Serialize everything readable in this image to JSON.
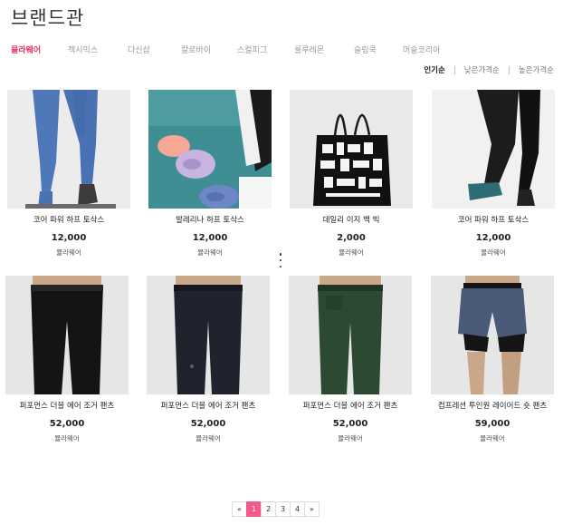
{
  "page": {
    "title": "브랜드관"
  },
  "brand_tabs": [
    {
      "label": "뮬라웨어",
      "active": true
    },
    {
      "label": "젝시믹스",
      "active": false
    },
    {
      "label": "다신샵",
      "active": false
    },
    {
      "label": "칼로바이",
      "active": false
    },
    {
      "label": "스컬피그",
      "active": false
    },
    {
      "label": "룰루레몬",
      "active": false
    },
    {
      "label": "슬림쿡",
      "active": false
    },
    {
      "label": "머슬코리아",
      "active": false
    }
  ],
  "sort_options": [
    {
      "label": "인기순",
      "active": true
    },
    {
      "label": "낮은가격순",
      "active": false
    },
    {
      "label": "높은가격순",
      "active": false
    }
  ],
  "products": [
    {
      "name": "코어 파워 하프 토삭스",
      "price": "12,000",
      "brand": "뮬라웨어",
      "image": "blue-leggings-photo"
    },
    {
      "name": "발레리나 하프 토삭스",
      "price": "12,000",
      "brand": "뮬라웨어",
      "image": "ballerina-socks-photo"
    },
    {
      "name": "데일리 이지 백 빅",
      "price": "2,000",
      "brand": "뮬라웨어",
      "image": "tote-bag-photo"
    },
    {
      "name": "코어 파워 하프 토삭스",
      "price": "12,000",
      "brand": "뮬라웨어",
      "image": "black-leggings-photo"
    },
    {
      "name": "퍼포먼스 더블 에어 조거 팬츠",
      "price": "52,000",
      "brand": "뮬라웨어",
      "image": "black-jogger-photo"
    },
    {
      "name": "퍼포먼스 더블 에어 조거 팬츠",
      "price": "52,000",
      "brand": "뮬라웨어",
      "image": "navy-jogger-photo"
    },
    {
      "name": "퍼포먼스 더블 에어 조거 팬츠",
      "price": "52,000",
      "brand": "뮬라웨어",
      "image": "green-jogger-photo"
    },
    {
      "name": "컴프레션 투인원 레이어드 숏 팬츠",
      "price": "59,000",
      "brand": "뮬라웨어",
      "image": "layered-shorts-photo"
    }
  ],
  "pagination": {
    "prev": "«",
    "pages": [
      "1",
      "2",
      "3",
      "4"
    ],
    "current": "1",
    "next": "»"
  },
  "colors": {
    "accent": "#e4335f",
    "page_active": "#f25a8a"
  },
  "icons": {
    "more": "vertical-ellipsis-icon"
  }
}
